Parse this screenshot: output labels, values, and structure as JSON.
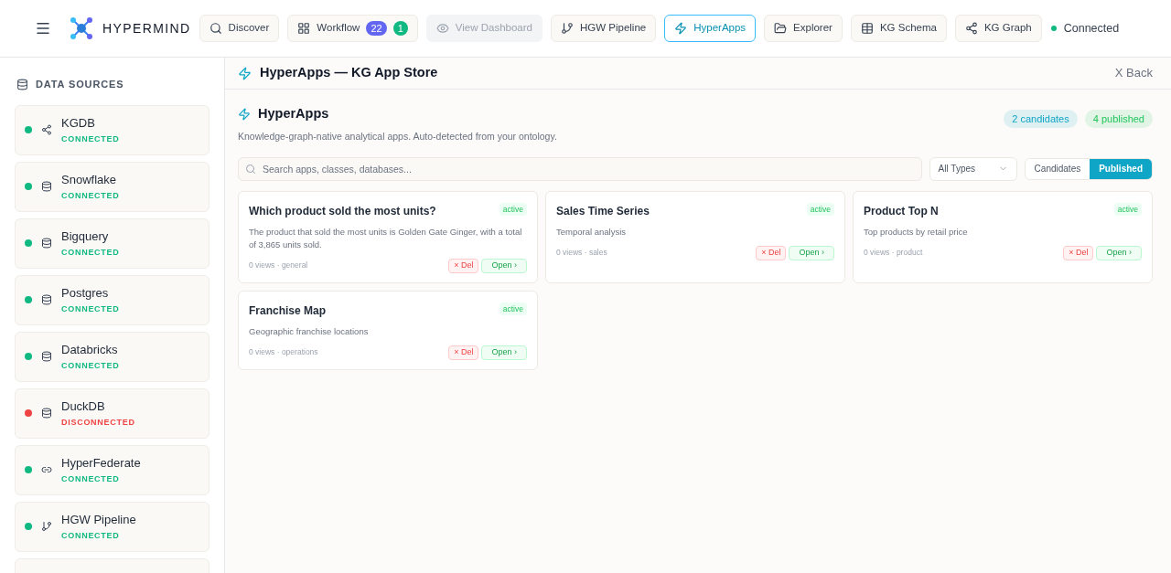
{
  "header": {
    "brand": "HYPERMIND",
    "nav": [
      {
        "kind": "search",
        "label": "Discover",
        "selected": false,
        "disabled": false
      },
      {
        "kind": "grid",
        "label": "Workflow",
        "selected": false,
        "disabled": false,
        "badges": [
          {
            "text": "22",
            "color": "#6366f1"
          },
          {
            "text": "1",
            "color": "#10b981"
          }
        ]
      },
      {
        "kind": "eye",
        "label": "View Dashboard",
        "selected": false,
        "disabled": true
      },
      {
        "kind": "branch",
        "label": "HGW Pipeline",
        "selected": false,
        "disabled": false
      },
      {
        "kind": "zap",
        "label": "HyperApps",
        "selected": true,
        "disabled": false
      },
      {
        "kind": "folder",
        "label": "Explorer",
        "selected": false,
        "disabled": false
      },
      {
        "kind": "table",
        "label": "KG Schema",
        "selected": false,
        "disabled": false
      },
      {
        "kind": "share",
        "label": "KG Graph",
        "selected": false,
        "disabled": false
      }
    ],
    "status": {
      "label": "Connected",
      "color": "#10b981"
    }
  },
  "sidebar": {
    "title": "DATA SOURCES",
    "sources": [
      {
        "kind": "graph",
        "name": "KGDB",
        "status": "CONNECTED",
        "connected": true
      },
      {
        "kind": "database",
        "name": "Snowflake",
        "status": "CONNECTED",
        "connected": true
      },
      {
        "kind": "database",
        "name": "Bigquery",
        "status": "CONNECTED",
        "connected": true
      },
      {
        "kind": "database",
        "name": "Postgres",
        "status": "CONNECTED",
        "connected": true
      },
      {
        "kind": "database",
        "name": "Databricks",
        "status": "CONNECTED",
        "connected": true
      },
      {
        "kind": "database",
        "name": "DuckDB",
        "status": "DISCONNECTED",
        "connected": false
      },
      {
        "kind": "link",
        "name": "HyperFederate",
        "status": "CONNECTED",
        "connected": true
      },
      {
        "kind": "branch",
        "name": "HGW Pipeline",
        "status": "CONNECTED",
        "connected": true
      }
    ]
  },
  "panel": {
    "title": "HyperApps — KG App Store",
    "back": "X Back",
    "heading": "HyperApps",
    "subtitle": "Knowledge-graph-native analytical apps. Auto-detected from your ontology.",
    "counts": [
      {
        "text": "2 candidates",
        "color": "#0ea5c6"
      },
      {
        "text": "4 published",
        "color": "#22c55e"
      }
    ],
    "search": {
      "placeholder": "Search apps, classes, databases..."
    },
    "filter": {
      "value": "All Types"
    },
    "tabs": [
      {
        "label": "Candidates",
        "selected": false
      },
      {
        "label": "Published",
        "selected": true
      }
    ],
    "apps": [
      {
        "title": "Which product sold the most units?",
        "status": "active",
        "description": "The product that sold the most units is Golden Gate Ginger, with a total of 3,865 units sold.",
        "meta": "0 views · general",
        "delete": "× Del",
        "open": "Open ›"
      },
      {
        "title": "Sales Time Series",
        "status": "active",
        "description": "Temporal analysis",
        "meta": "0 views · sales",
        "delete": "× Del",
        "open": "Open ›"
      },
      {
        "title": "Product Top N",
        "status": "active",
        "description": "Top products by retail price",
        "meta": "0 views · product",
        "delete": "× Del",
        "open": "Open ›"
      },
      {
        "title": "Franchise Map",
        "status": "active",
        "description": "Geographic franchise locations",
        "meta": "0 views · operations",
        "delete": "× Del",
        "open": "Open ›"
      }
    ]
  }
}
